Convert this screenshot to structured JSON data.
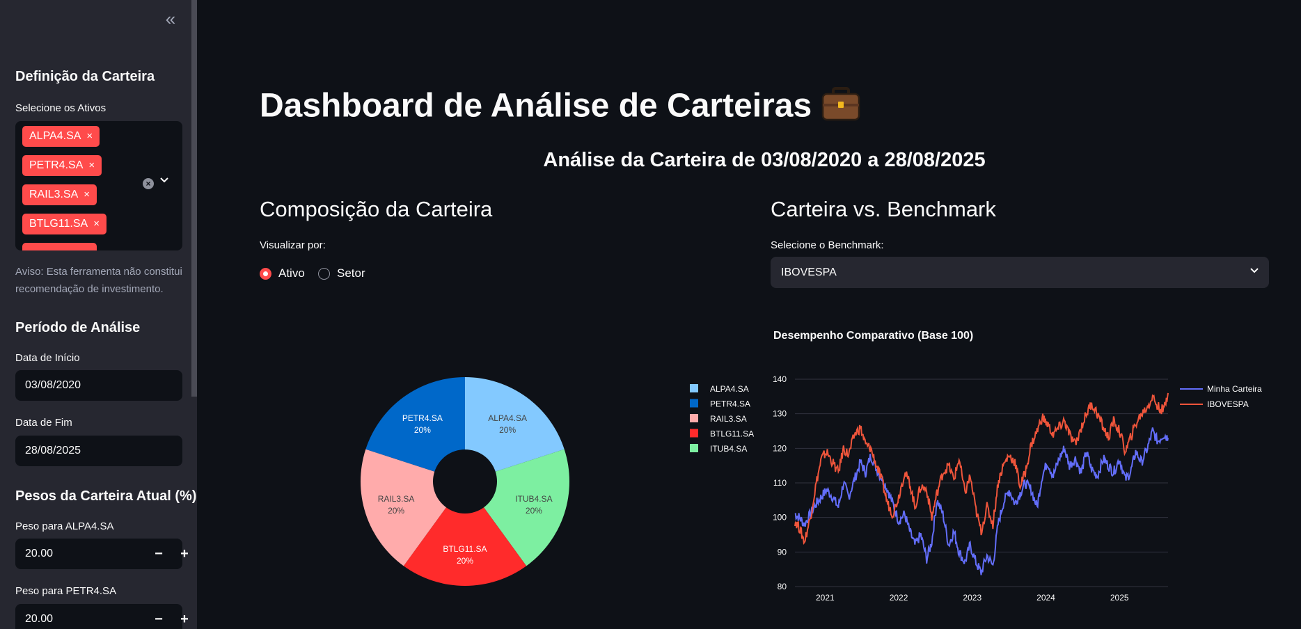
{
  "sidebar": {
    "collapse_icon": "double-chevron-left-icon",
    "collapse_glyph": "«",
    "portfolio_header": "Definição da Carteira",
    "assets_label": "Selecione os Ativos",
    "selected_assets": [
      "ALPA4.SA",
      "PETR4.SA",
      "RAIL3.SA",
      "BTLG11.SA"
    ],
    "tag_remove_glyph": "×",
    "clear_glyph": "×",
    "dropdown_glyph": "⌄",
    "disclaimer": "Aviso: Esta ferramenta não constitui recomendação de investimento.",
    "period_header": "Período de Análise",
    "start_label": "Data de Início",
    "start_value": "03/08/2020",
    "end_label": "Data de Fim",
    "end_value": "28/08/2025",
    "weights_header": "Pesos da Carteira Atual (%)",
    "weight1_label": "Peso para ALPA4.SA",
    "weight1_value": "20.00",
    "weight2_label": "Peso para PETR4.SA",
    "weight2_value": "20.00",
    "minus_glyph": "−",
    "plus_glyph": "+"
  },
  "main": {
    "title": "Dashboard de Análise de Carteiras",
    "title_icon": "briefcase-icon",
    "subtitle": "Análise da Carteira de 03/08/2020 a 28/08/2025",
    "composition_header": "Composição da Carteira",
    "view_by_label": "Visualizar por:",
    "radio_options": [
      "Ativo",
      "Setor"
    ],
    "radio_selected": "Ativo",
    "benchmark_header": "Carteira vs. Benchmark",
    "benchmark_label": "Selecione o Benchmark:",
    "benchmark_value": "IBOVESPA"
  },
  "colors": {
    "accent": "#ff4b4b",
    "sidebar_bg": "#262730",
    "page_bg": "#0e1117"
  },
  "chart_data": [
    {
      "type": "pie",
      "hole": true,
      "slices": [
        {
          "label": "ALPA4.SA",
          "value": 20,
          "display": "20%",
          "color": "#83c9ff",
          "text_color": "#444444"
        },
        {
          "label": "ITUB4.SA",
          "value": 20,
          "display": "20%",
          "color": "#7defa1",
          "text_color": "#444444"
        },
        {
          "label": "BTLG11.SA",
          "value": 20,
          "display": "20%",
          "color": "#ff2b2b",
          "text_color": "#ffffff"
        },
        {
          "label": "RAIL3.SA",
          "value": 20,
          "display": "20%",
          "color": "#ffabab",
          "text_color": "#444444"
        },
        {
          "label": "PETR4.SA",
          "value": 20,
          "display": "20%",
          "color": "#0068c9",
          "text_color": "#ffffff"
        }
      ],
      "legend": [
        "ALPA4.SA",
        "PETR4.SA",
        "RAIL3.SA",
        "BTLG11.SA",
        "ITUB4.SA"
      ],
      "legend_position": "top-right"
    },
    {
      "type": "line",
      "title": "Desempenho Comparativo (Base 100)",
      "x_ticks": [
        "2021",
        "2022",
        "2023",
        "2024",
        "2025"
      ],
      "y_ticks": [
        80,
        90,
        100,
        110,
        120,
        130,
        140
      ],
      "ylim": [
        80,
        140
      ],
      "xlim": [
        2020.59,
        2025.66
      ],
      "grid": true,
      "legend_position": "top-right",
      "series": [
        {
          "name": "Minha Carteira",
          "color": "#636efa",
          "x": [
            2020.59,
            2020.65,
            2020.72,
            2020.8,
            2020.88,
            2020.95,
            2021.02,
            2021.1,
            2021.18,
            2021.25,
            2021.32,
            2021.4,
            2021.48,
            2021.55,
            2021.62,
            2021.7,
            2021.78,
            2021.85,
            2021.92,
            2022.0,
            2022.08,
            2022.15,
            2022.22,
            2022.3,
            2022.38,
            2022.45,
            2022.52,
            2022.6,
            2022.68,
            2022.75,
            2022.82,
            2022.9,
            2022.97,
            2023.05,
            2023.12,
            2023.2,
            2023.28,
            2023.35,
            2023.42,
            2023.5,
            2023.58,
            2023.65,
            2023.72,
            2023.8,
            2023.88,
            2023.95,
            2024.02,
            2024.1,
            2024.18,
            2024.25,
            2024.32,
            2024.4,
            2024.48,
            2024.55,
            2024.62,
            2024.7,
            2024.78,
            2024.85,
            2024.92,
            2025.0,
            2025.08,
            2025.15,
            2025.22,
            2025.3,
            2025.38,
            2025.45,
            2025.52,
            2025.6,
            2025.66
          ],
          "y": [
            101,
            100,
            98,
            101,
            104,
            106,
            108,
            106,
            103,
            110,
            106,
            111,
            116,
            113,
            118,
            114,
            111,
            108,
            104,
            99,
            101,
            96,
            92,
            95,
            88,
            93,
            105,
            101,
            92,
            96,
            90,
            87,
            92,
            87,
            84,
            89,
            86,
            98,
            104,
            108,
            104,
            107,
            110,
            108,
            103,
            112,
            116,
            112,
            117,
            120,
            115,
            117,
            113,
            119,
            114,
            112,
            117,
            115,
            113,
            117,
            111,
            113,
            119,
            116,
            120,
            125,
            122,
            124,
            123
          ]
        },
        {
          "name": "IBOVESPA",
          "color": "#ef553b",
          "x": [
            2020.59,
            2020.65,
            2020.72,
            2020.8,
            2020.88,
            2020.95,
            2021.02,
            2021.1,
            2021.18,
            2021.25,
            2021.32,
            2021.4,
            2021.48,
            2021.55,
            2021.62,
            2021.7,
            2021.78,
            2021.85,
            2021.92,
            2022.0,
            2022.08,
            2022.15,
            2022.22,
            2022.3,
            2022.38,
            2022.45,
            2022.52,
            2022.6,
            2022.68,
            2022.75,
            2022.82,
            2022.9,
            2022.97,
            2023.05,
            2023.12,
            2023.2,
            2023.28,
            2023.35,
            2023.42,
            2023.5,
            2023.58,
            2023.65,
            2023.72,
            2023.8,
            2023.88,
            2023.95,
            2024.02,
            2024.1,
            2024.18,
            2024.25,
            2024.32,
            2024.4,
            2024.48,
            2024.55,
            2024.62,
            2024.7,
            2024.78,
            2024.85,
            2024.92,
            2025.0,
            2025.08,
            2025.15,
            2025.22,
            2025.3,
            2025.38,
            2025.45,
            2025.52,
            2025.6,
            2025.66
          ],
          "y": [
            99,
            97,
            93,
            100,
            110,
            117,
            119,
            116,
            113,
            120,
            118,
            124,
            126,
            121,
            120,
            115,
            110,
            104,
            101,
            106,
            113,
            110,
            103,
            109,
            108,
            100,
            107,
            113,
            115,
            111,
            117,
            107,
            112,
            102,
            96,
            103,
            98,
            110,
            115,
            118,
            116,
            109,
            113,
            121,
            125,
            129,
            127,
            124,
            126,
            128,
            124,
            121,
            126,
            130,
            133,
            130,
            126,
            123,
            128,
            125,
            119,
            123,
            127,
            130,
            132,
            135,
            132,
            131,
            136
          ]
        }
      ]
    }
  ]
}
